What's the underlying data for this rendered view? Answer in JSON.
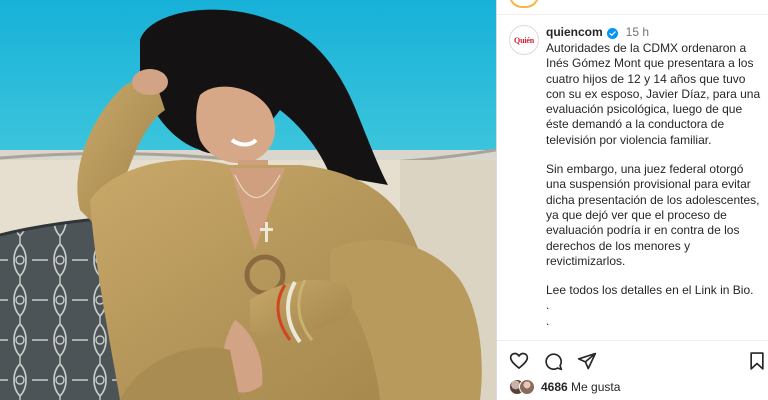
{
  "post": {
    "username": "quiencom",
    "avatar_text": "Quién",
    "time": "15 h",
    "caption_paragraphs": [
      [
        "Autoridades de la CDMX ordenaron a",
        "Inés Gómez Mont que presentara a los",
        "cuatro hijos de 12 y 14 años que tuvo",
        "con su ex esposo, Javier Díaz, para una",
        "evaluación psicológica, luego de que",
        "éste demandó a la conductora de",
        "televisión por violencia familiar."
      ],
      [
        "Sin embargo, una juez federal otorgó",
        "una suspensión provisional para evitar",
        "dicha presentación de los adolescentes,",
        "ya que dejó ver que el proceso de",
        "evaluación podría ir en contra de los",
        "derechos de los menores y",
        "revictimizarlos."
      ],
      [
        "Lee todos los detalles en el Link in Bio.",
        ".",
        "."
      ]
    ],
    "likes_count": "4686",
    "likes_label": "Me gusta"
  },
  "icons": {
    "like": "heart-icon",
    "comment": "comment-icon",
    "share": "share-icon",
    "save": "bookmark-icon",
    "verified": "verified-badge-icon"
  },
  "colors": {
    "text": "#262626",
    "muted": "#737373",
    "verified": "#0095f6",
    "brand_red": "#d11f2f",
    "sea": "#1fb8d8",
    "outfit": "#b5965a"
  }
}
